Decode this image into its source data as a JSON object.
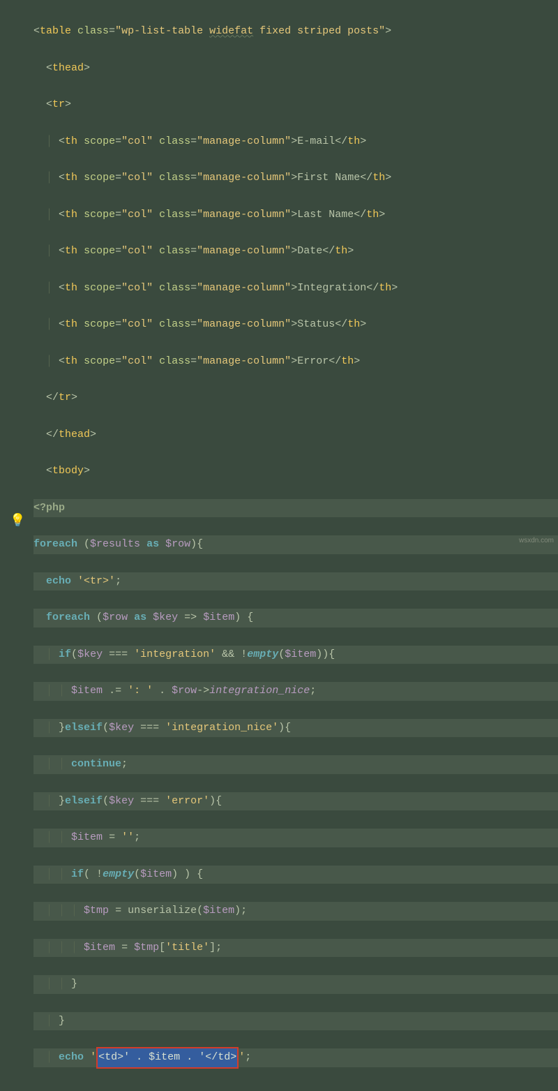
{
  "watermark": "wsxdn.com",
  "code": {
    "table_class": "wp-list-table widefat fixed striped posts",
    "table_class_wavy": "widefat",
    "scope": "col",
    "th_class": "manage-column",
    "cols": [
      "E-mail",
      "First Name",
      "Last Name",
      "Date",
      "Integration",
      "Status",
      "Error"
    ],
    "php_open": "<?php",
    "kw_foreach": "foreach",
    "kw_as": "as",
    "kw_echo": "echo",
    "kw_if": "if",
    "kw_elseif": "elseif",
    "kw_continue": "continue",
    "fn_empty": "empty",
    "fn_unserialize": "unserialize",
    "var_results": "$results",
    "var_row": "$row",
    "var_key": "$key",
    "var_item": "$item",
    "var_tmp": "$tmp",
    "str_tr": "'<tr>'",
    "str_integration": "'integration'",
    "str_colon": "': '",
    "prop_integration_nice": "integration_nice",
    "str_integration_nice": "'integration_nice'",
    "str_error": "'error'",
    "str_empty": "''",
    "str_title": "'title'",
    "sel_td_open": "<td>",
    "sel_td_close": "</td>"
  }
}
